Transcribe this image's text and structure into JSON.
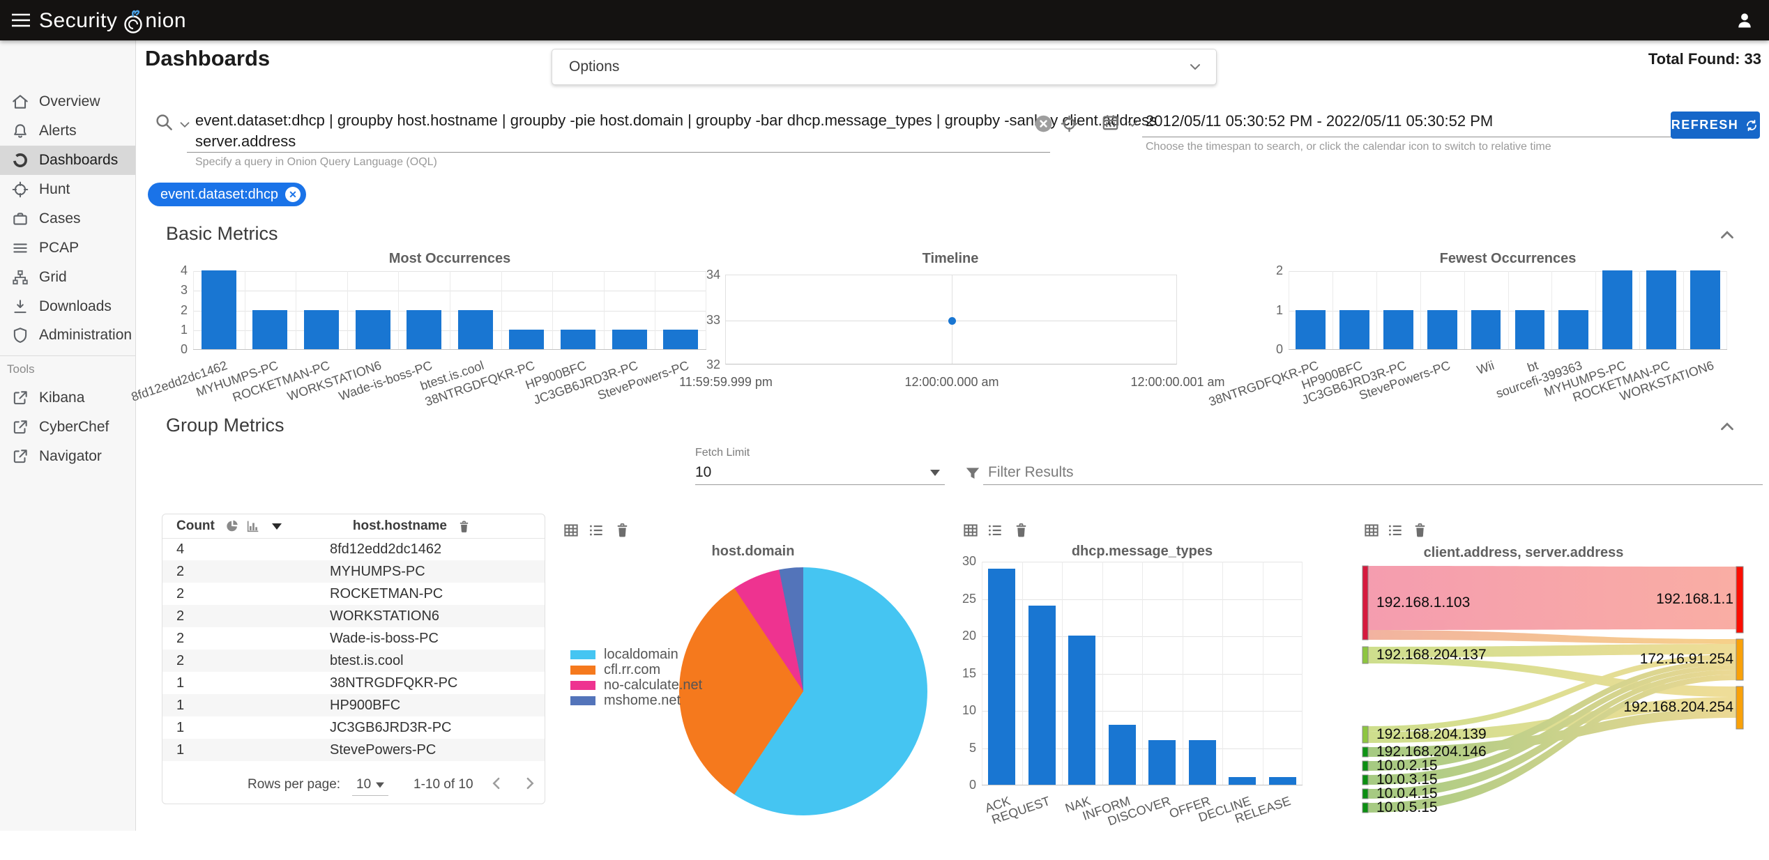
{
  "topbar": {
    "brand_prefix": "Security",
    "brand_suffix": "nion"
  },
  "sidebar": {
    "items": [
      {
        "label": "Overview"
      },
      {
        "label": "Alerts"
      },
      {
        "label": "Dashboards"
      },
      {
        "label": "Hunt"
      },
      {
        "label": "Cases"
      },
      {
        "label": "PCAP"
      },
      {
        "label": "Grid"
      },
      {
        "label": "Downloads"
      },
      {
        "label": "Administration"
      }
    ],
    "tools_label": "Tools",
    "tools": [
      {
        "label": "Kibana"
      },
      {
        "label": "CyberChef"
      },
      {
        "label": "Navigator"
      }
    ]
  },
  "header": {
    "title": "Dashboards",
    "options_label": "Options",
    "total_found": "Total Found: 33"
  },
  "search": {
    "query_line1": "event.dataset:dhcp | groupby host.hostname | groupby -pie host.domain | groupby -bar dhcp.message_types | groupby -sankey client.address",
    "query_line2": "server.address",
    "hint": "Specify a query in Onion Query Language (OQL)"
  },
  "timespan": {
    "range": "2012/05/11 05:30:52 PM - 2022/05/11 05:30:52 PM",
    "hint": "Choose the timespan to search, or click the calendar icon to switch to relative time",
    "refresh_label": "REFRESH"
  },
  "filter_chip": "event.dataset:dhcp",
  "sections": {
    "basic": "Basic Metrics",
    "group": "Group Metrics"
  },
  "group_controls": {
    "fetch_limit_label": "Fetch Limit",
    "fetch_limit_value": "10",
    "filter_placeholder": "Filter Results"
  },
  "table": {
    "columns": {
      "count": "Count",
      "host": "host.hostname"
    },
    "rows": [
      {
        "count": "4",
        "host": "8fd12edd2dc1462"
      },
      {
        "count": "2",
        "host": "MYHUMPS-PC"
      },
      {
        "count": "2",
        "host": "ROCKETMAN-PC"
      },
      {
        "count": "2",
        "host": "WORKSTATION6"
      },
      {
        "count": "2",
        "host": "Wade-is-boss-PC"
      },
      {
        "count": "2",
        "host": "btest.is.cool"
      },
      {
        "count": "1",
        "host": "38NTRGDFQKR-PC"
      },
      {
        "count": "1",
        "host": "HP900BFC"
      },
      {
        "count": "1",
        "host": "JC3GB6JRD3R-PC"
      },
      {
        "count": "1",
        "host": "StevePowers-PC"
      }
    ],
    "footer": {
      "rows_per_page_label": "Rows per page:",
      "rows_per_page_value": "10",
      "range_label": "1-10 of 10"
    }
  },
  "chart_data": [
    {
      "type": "bar",
      "title": "Most Occurrences",
      "categories": [
        "8fd12edd2dc1462",
        "MYHUMPS-PC",
        "ROCKETMAN-PC",
        "WORKSTATION6",
        "Wade-is-boss-PC",
        "btest.is.cool",
        "38NTRGDFQKR-PC",
        "HP900BFC",
        "JC3GB6JRD3R-PC",
        "StevePowers-PC"
      ],
      "values": [
        4,
        2,
        2,
        2,
        2,
        2,
        1,
        1,
        1,
        1
      ],
      "ylim": [
        0,
        4
      ],
      "yticks": [
        0,
        1,
        2,
        3,
        4
      ],
      "color": "#1976d2",
      "grid": true,
      "xlabel": "",
      "ylabel": ""
    },
    {
      "type": "scatter",
      "title": "Timeline",
      "x_ticks": [
        "11:59:59.999 pm",
        "12:00:00.000 am",
        "12:00:00.001 am"
      ],
      "yticks": [
        32,
        33,
        34
      ],
      "ylim": [
        32,
        34
      ],
      "points": [
        {
          "x": "12:00:00.000 am",
          "y": 33
        }
      ],
      "color": "#1976d2",
      "grid": true
    },
    {
      "type": "bar",
      "title": "Fewest Occurrences",
      "categories": [
        "38NTRGDFQKR-PC",
        "HP900BFC",
        "JC3GB6JRD3R-PC",
        "StevePowers-PC",
        "Wii",
        "bt",
        "sourcefi-399363",
        "MYHUMPS-PC",
        "ROCKETMAN-PC",
        "WORKSTATION6"
      ],
      "values": [
        1,
        1,
        1,
        1,
        1,
        1,
        1,
        2,
        2,
        2
      ],
      "ylim": [
        0,
        2
      ],
      "yticks": [
        0,
        1,
        2
      ],
      "color": "#1976d2",
      "grid": true
    },
    {
      "type": "pie",
      "title": "host.domain",
      "labels": [
        "localdomain",
        "cfl.rr.com",
        "no-calculate.net",
        "mshome.net"
      ],
      "values": [
        19,
        10,
        2,
        1
      ],
      "colors": [
        "#45c5f2",
        "#f5791d",
        "#ee3390",
        "#5374ba"
      ],
      "legend_position": "left"
    },
    {
      "type": "bar",
      "title": "dhcp.message_types",
      "categories": [
        "ACK",
        "REQUEST",
        "NAK",
        "INFORM",
        "DISCOVER",
        "OFFER",
        "DECLINE",
        "RELEASE"
      ],
      "values": [
        29,
        24,
        20,
        8,
        6,
        6,
        1,
        1
      ],
      "ylim": [
        0,
        30
      ],
      "yticks": [
        0,
        5,
        10,
        15,
        20,
        25,
        30
      ],
      "color": "#1976d2",
      "grid": true
    },
    {
      "type": "sankey",
      "title": "client.address, server.address",
      "nodes": [
        {
          "name": "192.168.1.103",
          "side": "left",
          "color": "#d6193d"
        },
        {
          "name": "192.168.204.137",
          "side": "left",
          "color": "#8dc63f"
        },
        {
          "name": "192.168.204.139",
          "side": "left",
          "color": "#8dc63f"
        },
        {
          "name": "192.168.204.146",
          "side": "left",
          "color": "#0f9415"
        },
        {
          "name": "10.0.2.15",
          "side": "left",
          "color": "#0b8f11"
        },
        {
          "name": "10.0.3.15",
          "side": "left",
          "color": "#0b8f11"
        },
        {
          "name": "10.0.4.15",
          "side": "left",
          "color": "#0b8f11"
        },
        {
          "name": "10.0.5.15",
          "side": "left",
          "color": "#0b8f11"
        },
        {
          "name": "192.168.1.1",
          "side": "right",
          "color": "#fb0d00"
        },
        {
          "name": "172.16.91.254",
          "side": "right",
          "color": "#f9a109"
        },
        {
          "name": "192.168.204.254",
          "side": "right",
          "color": "#f9a109"
        }
      ],
      "links": [
        {
          "source": "192.168.1.103",
          "target": "192.168.1.1",
          "value": 14
        },
        {
          "source": "192.168.1.103",
          "target": "172.16.91.254",
          "value": 1
        },
        {
          "source": "192.168.204.137",
          "target": "172.16.91.254",
          "value": 2
        },
        {
          "source": "192.168.204.137",
          "target": "192.168.204.254",
          "value": 2
        },
        {
          "source": "192.168.204.139",
          "target": "172.16.91.254",
          "value": 1
        },
        {
          "source": "192.168.204.139",
          "target": "192.168.204.254",
          "value": 2
        },
        {
          "source": "192.168.204.146",
          "target": "192.168.204.254",
          "value": 2
        },
        {
          "source": "10.0.2.15",
          "target": "172.16.91.254",
          "value": 1
        },
        {
          "source": "10.0.3.15",
          "target": "172.16.91.254",
          "value": 1
        },
        {
          "source": "10.0.4.15",
          "target": "172.16.91.254",
          "value": 1
        },
        {
          "source": "10.0.5.15",
          "target": "172.16.91.254",
          "value": 1
        }
      ]
    }
  ]
}
